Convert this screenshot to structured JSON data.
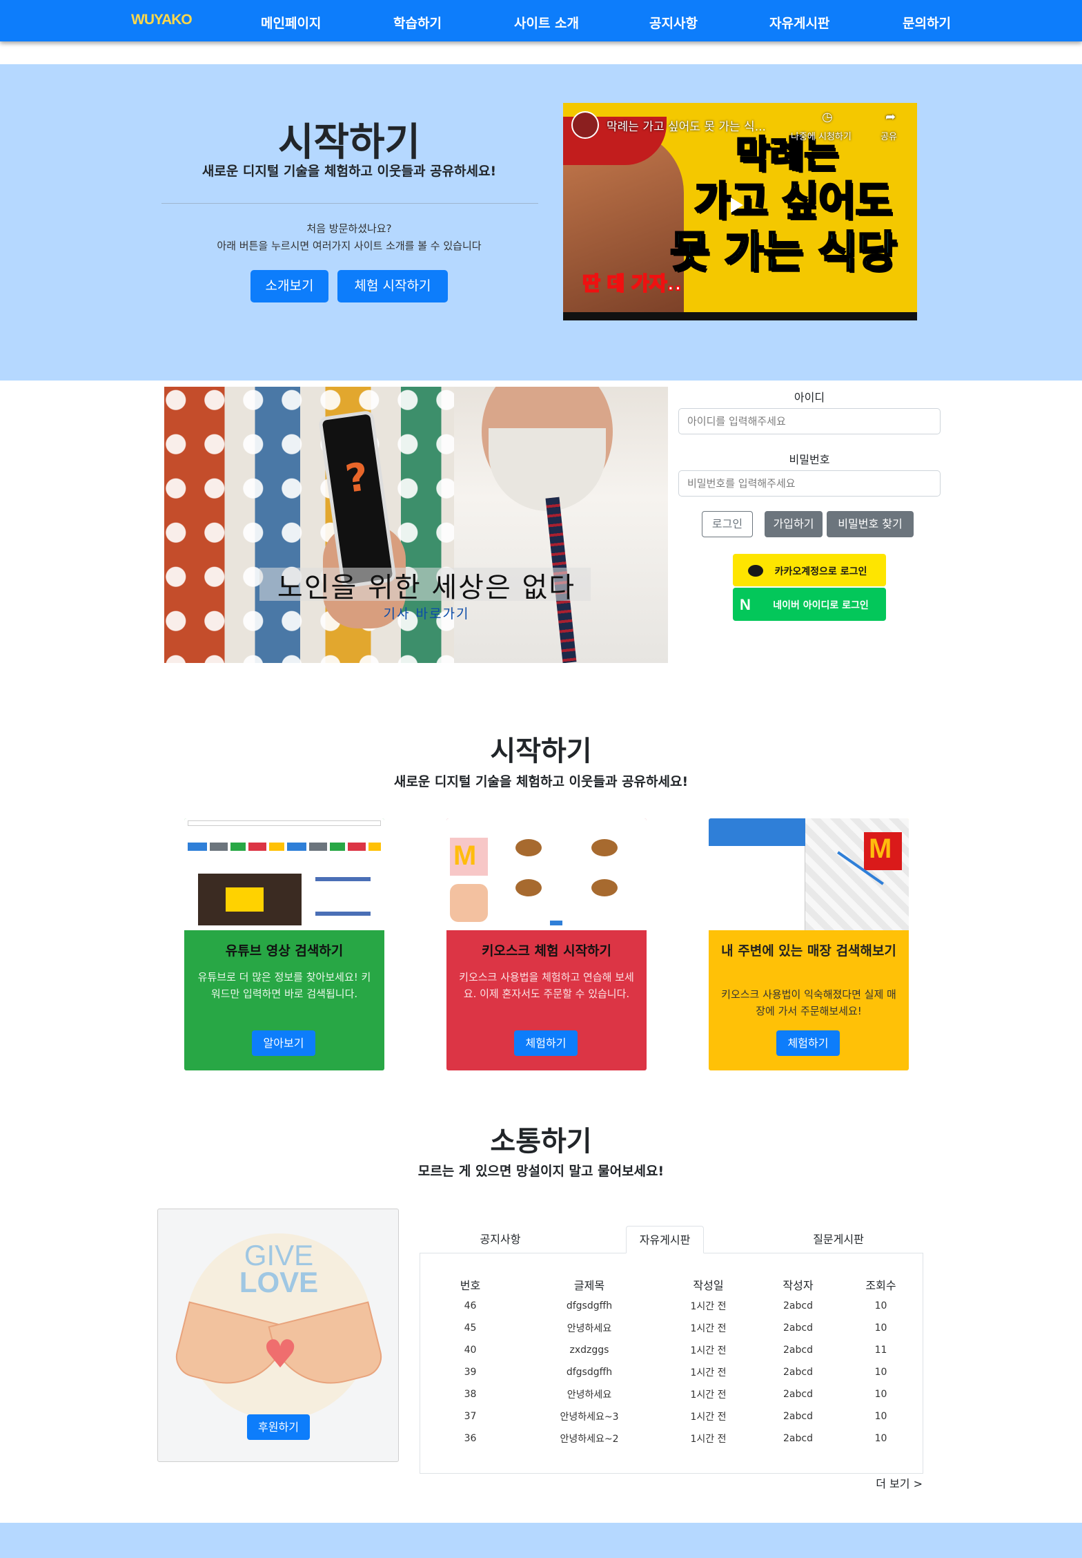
{
  "nav": {
    "logo": "WUYAKO",
    "items": [
      "메인페이지",
      "학습하기",
      "사이트 소개",
      "공지사항",
      "자유게시판",
      "문의하기"
    ]
  },
  "hero": {
    "title": "시작하기",
    "subtitle": "새로운 디지털 기술을 체험하고 이웃들과 공유하세요!",
    "desc_line1": "처음 방문하셨나요?",
    "desc_line2": "아래 버튼을 누르시면 여러가지 사이트 소개를 볼 수 있습니다",
    "intro_button": "소개보기",
    "start_button": "체험 시작하기",
    "video": {
      "title": "막례는 가고 싶어도 못 가는 식...",
      "watch_later": "나중에 시청하기",
      "share": "공유",
      "line1": "막례는",
      "line2": "가고 싶어도",
      "line3": "못 가는 식당",
      "ticker": "딴 데 가자.."
    }
  },
  "banner": {
    "caption": "노인을 위한 세상은 없다",
    "link": "기사 바로가기"
  },
  "login": {
    "id_label": "아이디",
    "id_placeholder": "아이디를 입력해주세요",
    "pw_label": "비밀번호",
    "pw_placeholder": "비밀번호를 입력해주세요",
    "login_button": "로그인",
    "signup_button": "가입하기",
    "find_pw_button": "비밀번호 찾기",
    "kakao_button": "카카오계정으로 로그인",
    "naver_button": "네이버 아이디로 로그인"
  },
  "start_section": {
    "title": "시작하기",
    "subtitle": "새로운 디지털 기술을 체험하고 이웃들과 공유하세요!",
    "cards": [
      {
        "title": "유튜브 영상 검색하기",
        "desc": "유튜브로 더 많은 정보를 찾아보세요! 키워드만 입력하면 바로 검색됩니다.",
        "button": "알아보기",
        "color": "#28a745"
      },
      {
        "title": "키오스크 체험 시작하기",
        "desc": "키오스크 사용법을 체험하고 연습해 보세요. 이제 혼자서도 주문할 수 있습니다.",
        "button": "체험하기",
        "color": "#dc3545"
      },
      {
        "title": "내 주변에 있는 매장 검색해보기",
        "desc": "키오스크 사용법이 익숙해졌다면 실제 매장에 가서 주문해보세요!",
        "button": "체험하기",
        "color": "#ffc107"
      }
    ]
  },
  "talk_section": {
    "title": "소통하기",
    "subtitle": "모르는 게 있으면 망설이지 말고 물어보세요!",
    "donate": {
      "give": "GIVE",
      "love": "LOVE",
      "button": "후원하기"
    },
    "tabs": [
      "공지사항",
      "자유게시판",
      "질문게시판"
    ],
    "active_tab": "자유게시판",
    "columns": [
      "번호",
      "글제목",
      "작성일",
      "작성자",
      "조회수"
    ],
    "rows": [
      [
        "46",
        "dfgsdgffh",
        "1시간 전",
        "2abcd",
        "10"
      ],
      [
        "45",
        "안녕하세요",
        "1시간 전",
        "2abcd",
        "10"
      ],
      [
        "40",
        "zxdzggs",
        "1시간 전",
        "2abcd",
        "11"
      ],
      [
        "39",
        "dfgsdgffh",
        "1시간 전",
        "2abcd",
        "10"
      ],
      [
        "38",
        "안녕하세요",
        "1시간 전",
        "2abcd",
        "10"
      ],
      [
        "37",
        "안녕하세요~3",
        "1시간 전",
        "2abcd",
        "10"
      ],
      [
        "36",
        "안녕하세요~2",
        "1시간 전",
        "2abcd",
        "10"
      ]
    ],
    "more": "더 보기 >"
  },
  "colors": {
    "primary": "#0d7dfb",
    "hero_bg": "#b5d8ff",
    "logo": "#ffd84a"
  }
}
